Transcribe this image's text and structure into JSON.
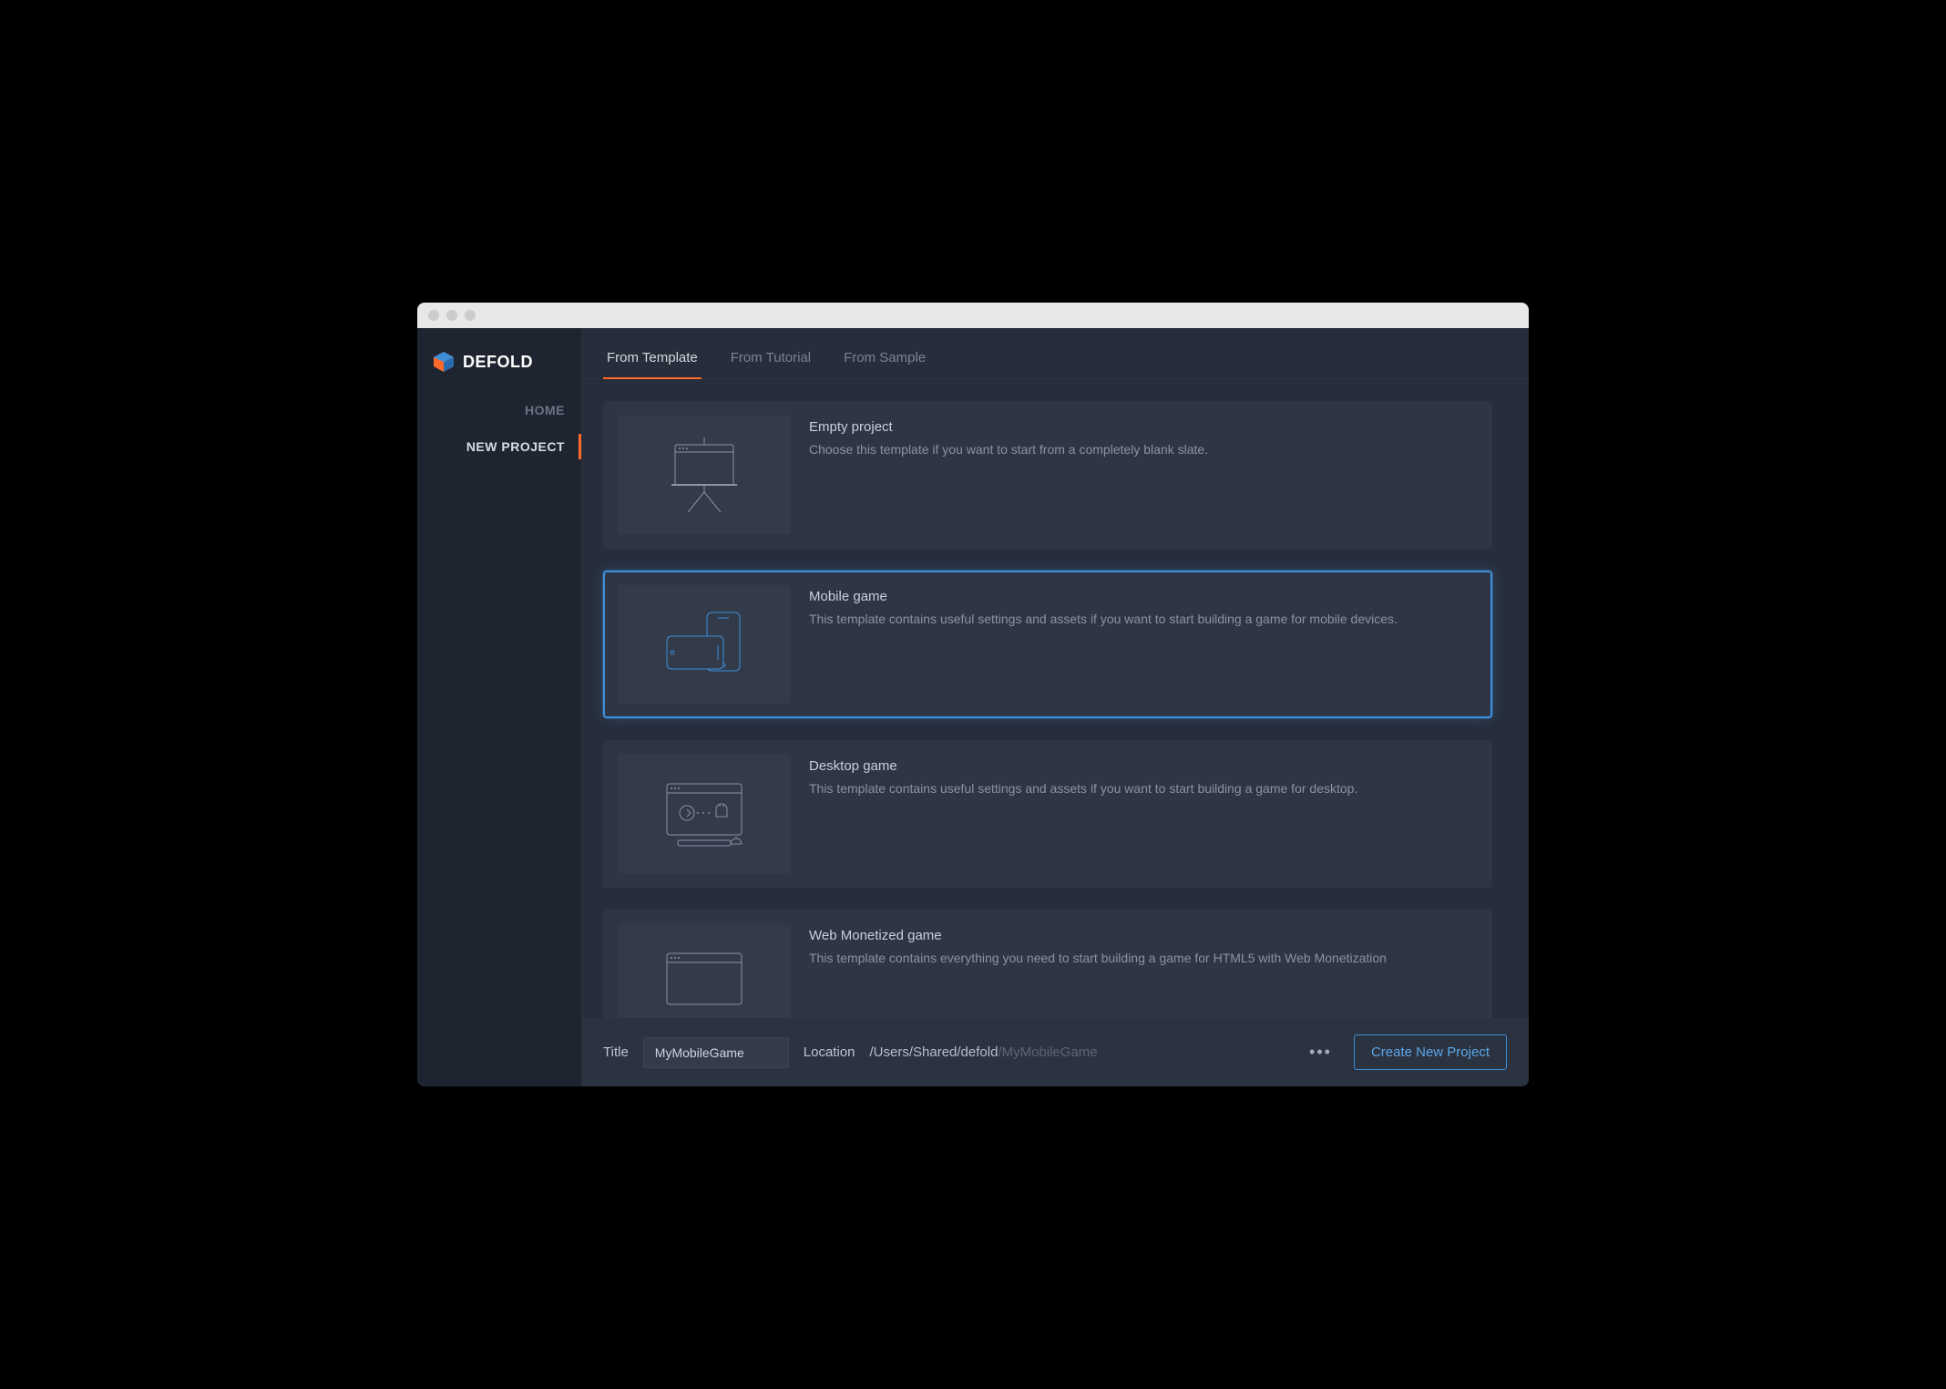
{
  "brand": {
    "name": "DEFOLD"
  },
  "sidebar": {
    "items": [
      {
        "label": "HOME",
        "active": false
      },
      {
        "label": "NEW PROJECT",
        "active": true
      }
    ]
  },
  "tabs": [
    {
      "label": "From Template",
      "active": true
    },
    {
      "label": "From Tutorial",
      "active": false
    },
    {
      "label": "From Sample",
      "active": false
    }
  ],
  "templates": [
    {
      "title": "Empty project",
      "desc": "Choose this template if you want to start from a completely blank slate.",
      "selected": false,
      "icon": "easel"
    },
    {
      "title": "Mobile game",
      "desc": "This template contains useful settings and assets if you want to start building a game for mobile devices.",
      "selected": true,
      "icon": "mobile"
    },
    {
      "title": "Desktop game",
      "desc": "This template contains useful settings and assets if you want to start building a game for desktop.",
      "selected": false,
      "icon": "desktop"
    },
    {
      "title": "Web Monetized game",
      "desc": "This template contains everything you need to start building a game for HTML5 with Web Monetization",
      "selected": false,
      "icon": "web"
    }
  ],
  "footer": {
    "title_label": "Title",
    "title_value": "MyMobileGame",
    "location_label": "Location",
    "location_path": "/Users/Shared/defold",
    "location_suffix": "/MyMobileGame",
    "create_label": "Create New Project"
  }
}
